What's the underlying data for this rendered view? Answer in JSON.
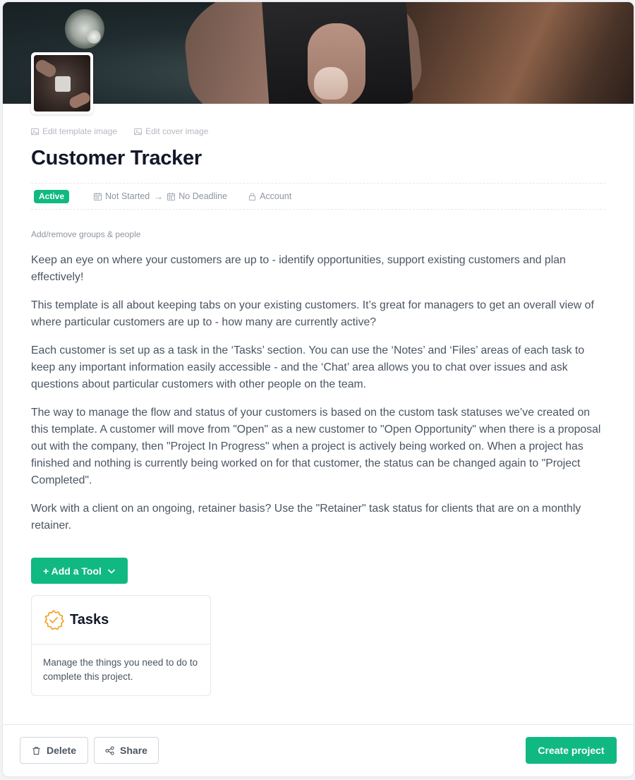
{
  "template": {
    "edit_template_image": "Edit template image",
    "edit_cover_image": "Edit cover image",
    "title": "Customer Tracker"
  },
  "meta": {
    "status": "Active",
    "start": "Not Started",
    "deadline": "No Deadline",
    "visibility": "Account"
  },
  "groups_link": "Add/remove groups & people",
  "description": [
    "Keep an eye on where your customers are up to - identify opportunities, support existing customers and plan effectively!",
    "This template is all about keeping tabs on your existing customers. It’s great for managers to get an overall view of where particular customers are up to - how many are currently active?",
    "Each customer is set up as a task in the ‘Tasks’ section. You can use the ‘Notes’ and ‘Files’ areas of each task to keep any important information easily accessible - and the ‘Chat’ area allows you to chat over issues and ask questions about particular customers with other people on the team.",
    "The way to manage the flow and status of your customers is based on the custom task statuses we’ve created on this template. A customer will move from \"Open\" as a new customer to \"Open Opportunity\" when there is a proposal out with the company, then \"Project In Progress\" when a project is actively being worked on. When a project has finished and nothing is currently being worked on for that customer, the status can be changed again to \"Project Completed\".",
    "Work with a client on an ongoing, retainer basis? Use the \"Retainer\" task status for clients that are on a monthly retainer."
  ],
  "add_tool_label": "+ Add a Tool",
  "tools": [
    {
      "name": "Tasks",
      "description": "Manage the things you need to do to complete this project."
    }
  ],
  "footer": {
    "delete_label": "Delete",
    "share_label": "Share",
    "create_label": "Create project"
  },
  "colors": {
    "accent": "#10b981",
    "title": "#111827",
    "muted": "#8e959f",
    "tool_icon": "#f0a830"
  },
  "icons": [
    "image-icon",
    "calendar-icon",
    "arrow-right-icon",
    "lock-icon",
    "chevron-down-icon",
    "verified-badge-icon",
    "trash-icon",
    "share-icon"
  ]
}
